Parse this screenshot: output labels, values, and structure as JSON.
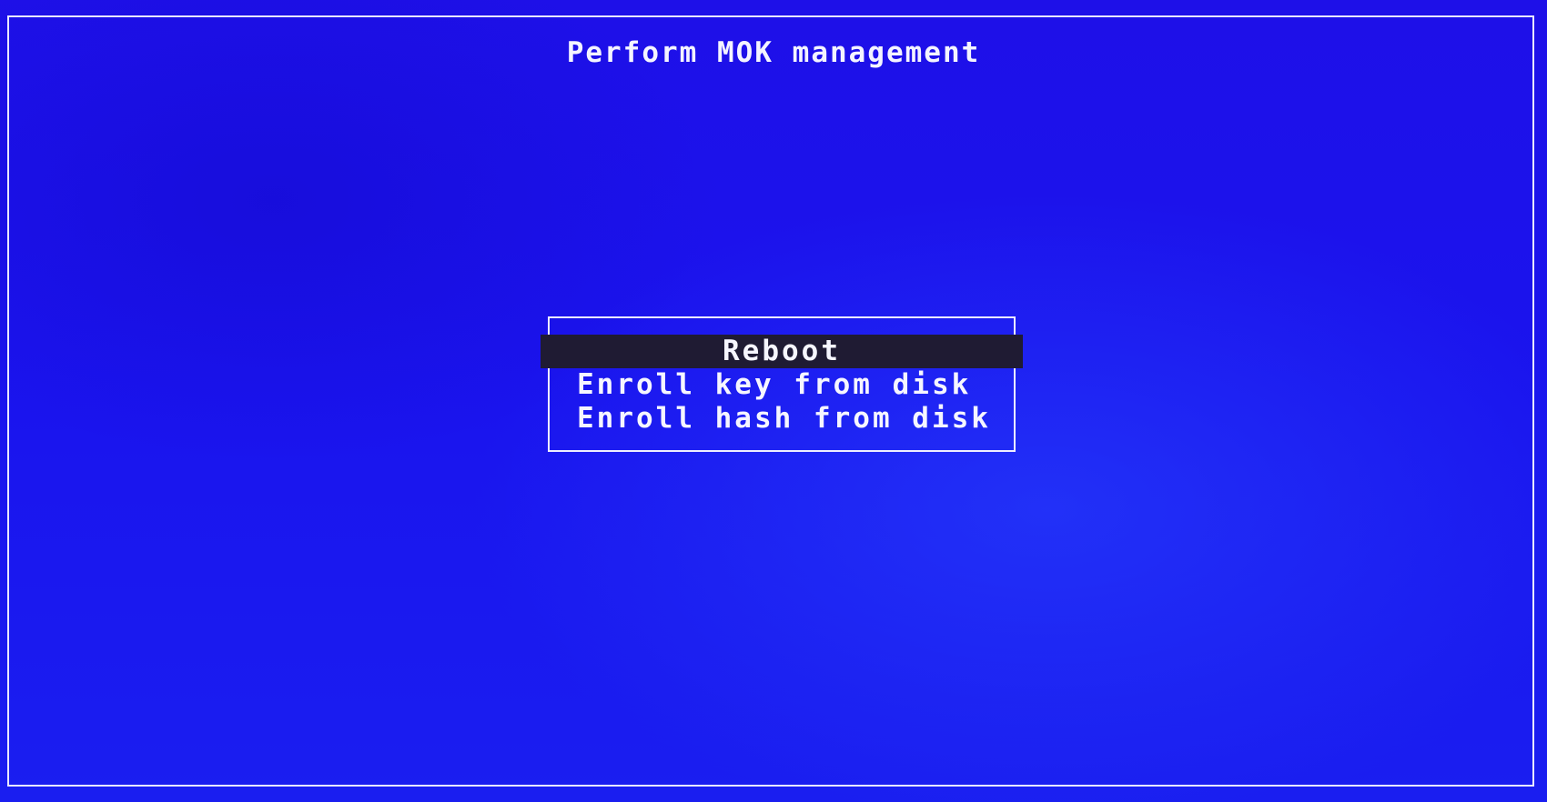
{
  "screen": {
    "background_color": "#1c10e6",
    "title": "Perform MOK management"
  },
  "menu": {
    "selected_index": 0,
    "selected_color": "#1f1b33",
    "items": [
      {
        "label": "Reboot"
      },
      {
        "label": "Enroll key from disk"
      },
      {
        "label": "Enroll hash from disk"
      }
    ]
  }
}
